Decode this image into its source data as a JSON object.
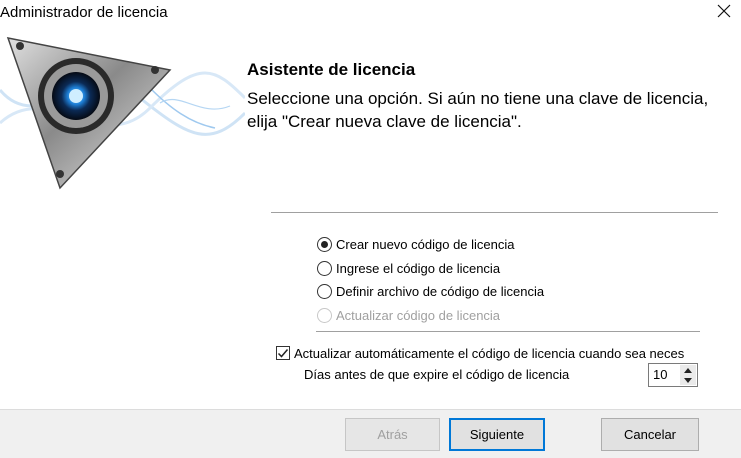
{
  "window": {
    "title": "Administrador de licencia",
    "close_icon": "close-icon"
  },
  "header": {
    "heading": "Asistente de licencia",
    "description": "Seleccione una opción. Si aún no tiene una clave de licencia, elija \"Crear nueva clave de licencia\"."
  },
  "options": [
    {
      "label": "Crear nuevo código de licencia",
      "checked": true,
      "enabled": true
    },
    {
      "label": "Ingrese el código de licencia",
      "checked": false,
      "enabled": true
    },
    {
      "label": "Definir archivo de código de licencia",
      "checked": false,
      "enabled": true
    },
    {
      "label": "Actualizar código de licencia",
      "checked": false,
      "enabled": false
    }
  ],
  "auto_update": {
    "label": "Actualizar automáticamente el código de licencia cuando sea neces",
    "checked": true
  },
  "days": {
    "label": "Días antes de que expire el código de licencia",
    "value": "10"
  },
  "buttons": {
    "back": "Atrás",
    "next": "Siguiente",
    "cancel": "Cancelar"
  },
  "colors": {
    "accent": "#0078d7",
    "footer_bg": "#f0f0f0",
    "disabled_text": "#a0a0a0"
  }
}
